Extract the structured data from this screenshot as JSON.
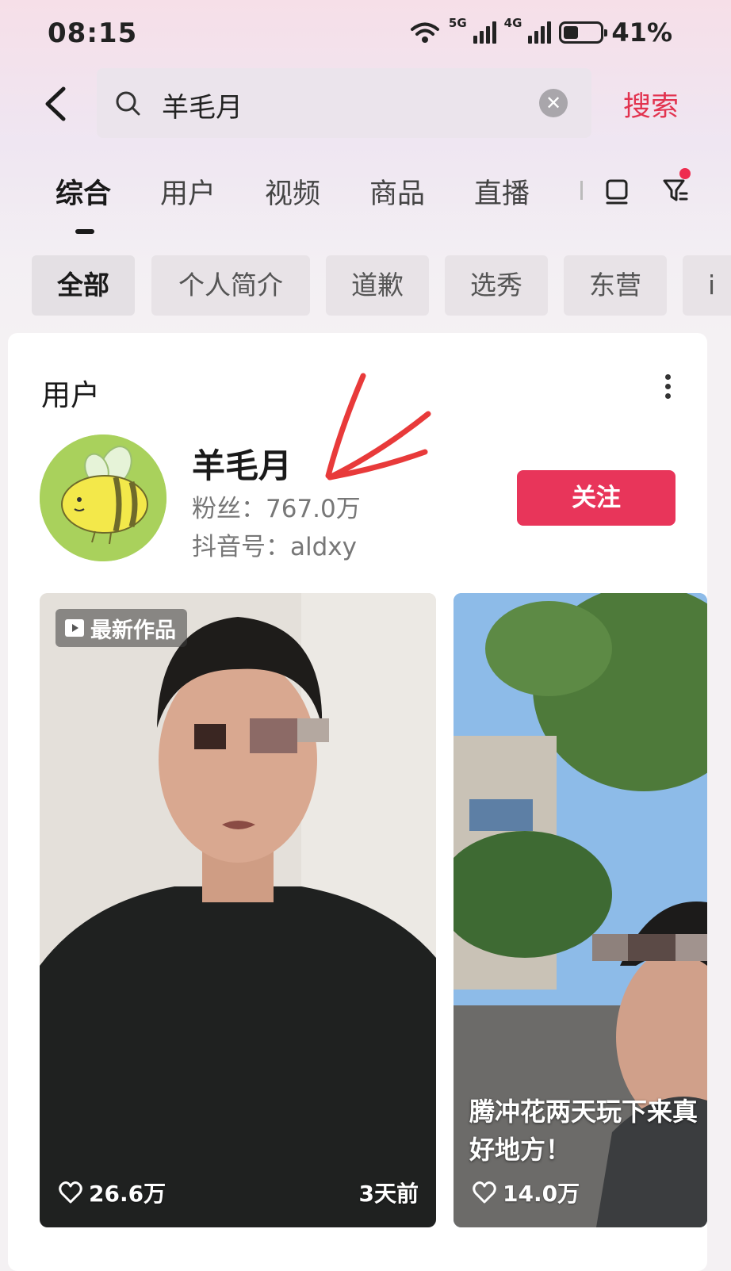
{
  "status_bar": {
    "time": "08:15",
    "network_1": "5G",
    "network_2": "4G",
    "battery_level": 0.41,
    "battery_text": "41%"
  },
  "search": {
    "query": "羊毛月",
    "action_label": "搜索",
    "icons": [
      "back-arrow-icon",
      "search-icon",
      "clear-icon"
    ]
  },
  "tabs": [
    {
      "label": "综合",
      "active": true
    },
    {
      "label": "用户",
      "active": false
    },
    {
      "label": "视频",
      "active": false
    },
    {
      "label": "商品",
      "active": false
    },
    {
      "label": "直播",
      "active": false
    }
  ],
  "chips": [
    {
      "label": "全部",
      "active": true
    },
    {
      "label": "个人简介",
      "active": false
    },
    {
      "label": "道歉",
      "active": false
    },
    {
      "label": "选秀",
      "active": false
    },
    {
      "label": "东营",
      "active": false
    },
    {
      "label": "i",
      "active": false
    }
  ],
  "user_section": {
    "title": "用户",
    "name": "羊毛月",
    "fans": "粉丝：767.0万",
    "douyin_id": "抖音号：aldxy",
    "follow_label": "关注"
  },
  "videos": [
    {
      "badge": "最新作品",
      "likes": "26.6万",
      "time_ago": "3天前",
      "caption": ""
    },
    {
      "badge": "",
      "likes": "14.0万",
      "time_ago": "",
      "caption_line1": "腾冲花两天玩下来真",
      "caption_line2": "好地方！"
    }
  ],
  "colors": {
    "accent": "#e8355a",
    "search_text": "#e2334f",
    "annotation_arrow": "#e83a3a"
  }
}
